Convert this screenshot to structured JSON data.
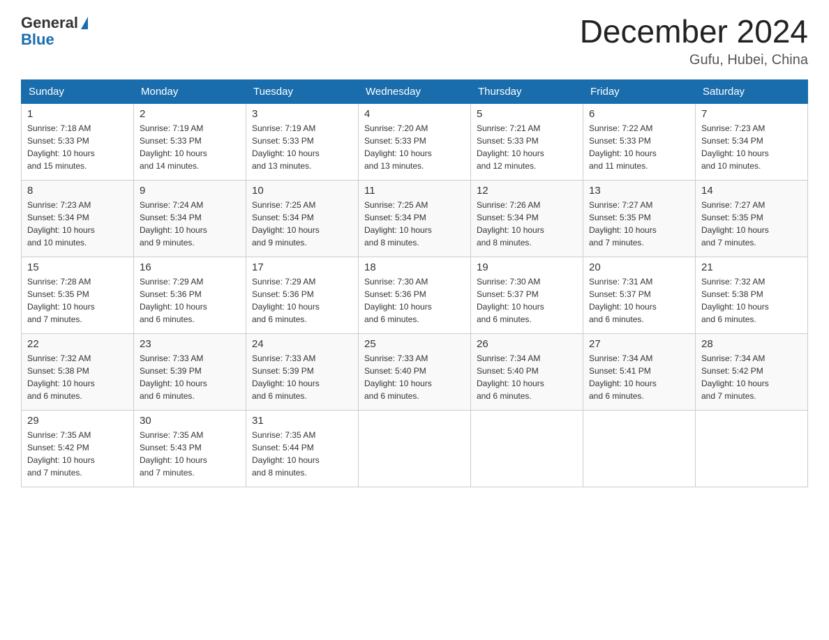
{
  "logo": {
    "general": "General",
    "blue": "Blue"
  },
  "header": {
    "title": "December 2024",
    "location": "Gufu, Hubei, China"
  },
  "weekdays": [
    "Sunday",
    "Monday",
    "Tuesday",
    "Wednesday",
    "Thursday",
    "Friday",
    "Saturday"
  ],
  "weeks": [
    [
      {
        "day": "1",
        "sunrise": "7:18 AM",
        "sunset": "5:33 PM",
        "daylight": "10 hours and 15 minutes."
      },
      {
        "day": "2",
        "sunrise": "7:19 AM",
        "sunset": "5:33 PM",
        "daylight": "10 hours and 14 minutes."
      },
      {
        "day": "3",
        "sunrise": "7:19 AM",
        "sunset": "5:33 PM",
        "daylight": "10 hours and 13 minutes."
      },
      {
        "day": "4",
        "sunrise": "7:20 AM",
        "sunset": "5:33 PM",
        "daylight": "10 hours and 13 minutes."
      },
      {
        "day": "5",
        "sunrise": "7:21 AM",
        "sunset": "5:33 PM",
        "daylight": "10 hours and 12 minutes."
      },
      {
        "day": "6",
        "sunrise": "7:22 AM",
        "sunset": "5:33 PM",
        "daylight": "10 hours and 11 minutes."
      },
      {
        "day": "7",
        "sunrise": "7:23 AM",
        "sunset": "5:34 PM",
        "daylight": "10 hours and 10 minutes."
      }
    ],
    [
      {
        "day": "8",
        "sunrise": "7:23 AM",
        "sunset": "5:34 PM",
        "daylight": "10 hours and 10 minutes."
      },
      {
        "day": "9",
        "sunrise": "7:24 AM",
        "sunset": "5:34 PM",
        "daylight": "10 hours and 9 minutes."
      },
      {
        "day": "10",
        "sunrise": "7:25 AM",
        "sunset": "5:34 PM",
        "daylight": "10 hours and 9 minutes."
      },
      {
        "day": "11",
        "sunrise": "7:25 AM",
        "sunset": "5:34 PM",
        "daylight": "10 hours and 8 minutes."
      },
      {
        "day": "12",
        "sunrise": "7:26 AM",
        "sunset": "5:34 PM",
        "daylight": "10 hours and 8 minutes."
      },
      {
        "day": "13",
        "sunrise": "7:27 AM",
        "sunset": "5:35 PM",
        "daylight": "10 hours and 7 minutes."
      },
      {
        "day": "14",
        "sunrise": "7:27 AM",
        "sunset": "5:35 PM",
        "daylight": "10 hours and 7 minutes."
      }
    ],
    [
      {
        "day": "15",
        "sunrise": "7:28 AM",
        "sunset": "5:35 PM",
        "daylight": "10 hours and 7 minutes."
      },
      {
        "day": "16",
        "sunrise": "7:29 AM",
        "sunset": "5:36 PM",
        "daylight": "10 hours and 6 minutes."
      },
      {
        "day": "17",
        "sunrise": "7:29 AM",
        "sunset": "5:36 PM",
        "daylight": "10 hours and 6 minutes."
      },
      {
        "day": "18",
        "sunrise": "7:30 AM",
        "sunset": "5:36 PM",
        "daylight": "10 hours and 6 minutes."
      },
      {
        "day": "19",
        "sunrise": "7:30 AM",
        "sunset": "5:37 PM",
        "daylight": "10 hours and 6 minutes."
      },
      {
        "day": "20",
        "sunrise": "7:31 AM",
        "sunset": "5:37 PM",
        "daylight": "10 hours and 6 minutes."
      },
      {
        "day": "21",
        "sunrise": "7:32 AM",
        "sunset": "5:38 PM",
        "daylight": "10 hours and 6 minutes."
      }
    ],
    [
      {
        "day": "22",
        "sunrise": "7:32 AM",
        "sunset": "5:38 PM",
        "daylight": "10 hours and 6 minutes."
      },
      {
        "day": "23",
        "sunrise": "7:33 AM",
        "sunset": "5:39 PM",
        "daylight": "10 hours and 6 minutes."
      },
      {
        "day": "24",
        "sunrise": "7:33 AM",
        "sunset": "5:39 PM",
        "daylight": "10 hours and 6 minutes."
      },
      {
        "day": "25",
        "sunrise": "7:33 AM",
        "sunset": "5:40 PM",
        "daylight": "10 hours and 6 minutes."
      },
      {
        "day": "26",
        "sunrise": "7:34 AM",
        "sunset": "5:40 PM",
        "daylight": "10 hours and 6 minutes."
      },
      {
        "day": "27",
        "sunrise": "7:34 AM",
        "sunset": "5:41 PM",
        "daylight": "10 hours and 6 minutes."
      },
      {
        "day": "28",
        "sunrise": "7:34 AM",
        "sunset": "5:42 PM",
        "daylight": "10 hours and 7 minutes."
      }
    ],
    [
      {
        "day": "29",
        "sunrise": "7:35 AM",
        "sunset": "5:42 PM",
        "daylight": "10 hours and 7 minutes."
      },
      {
        "day": "30",
        "sunrise": "7:35 AM",
        "sunset": "5:43 PM",
        "daylight": "10 hours and 7 minutes."
      },
      {
        "day": "31",
        "sunrise": "7:35 AM",
        "sunset": "5:44 PM",
        "daylight": "10 hours and 8 minutes."
      },
      null,
      null,
      null,
      null
    ]
  ],
  "labels": {
    "sunrise_prefix": "Sunrise: ",
    "sunset_prefix": "Sunset: ",
    "daylight_prefix": "Daylight: "
  }
}
